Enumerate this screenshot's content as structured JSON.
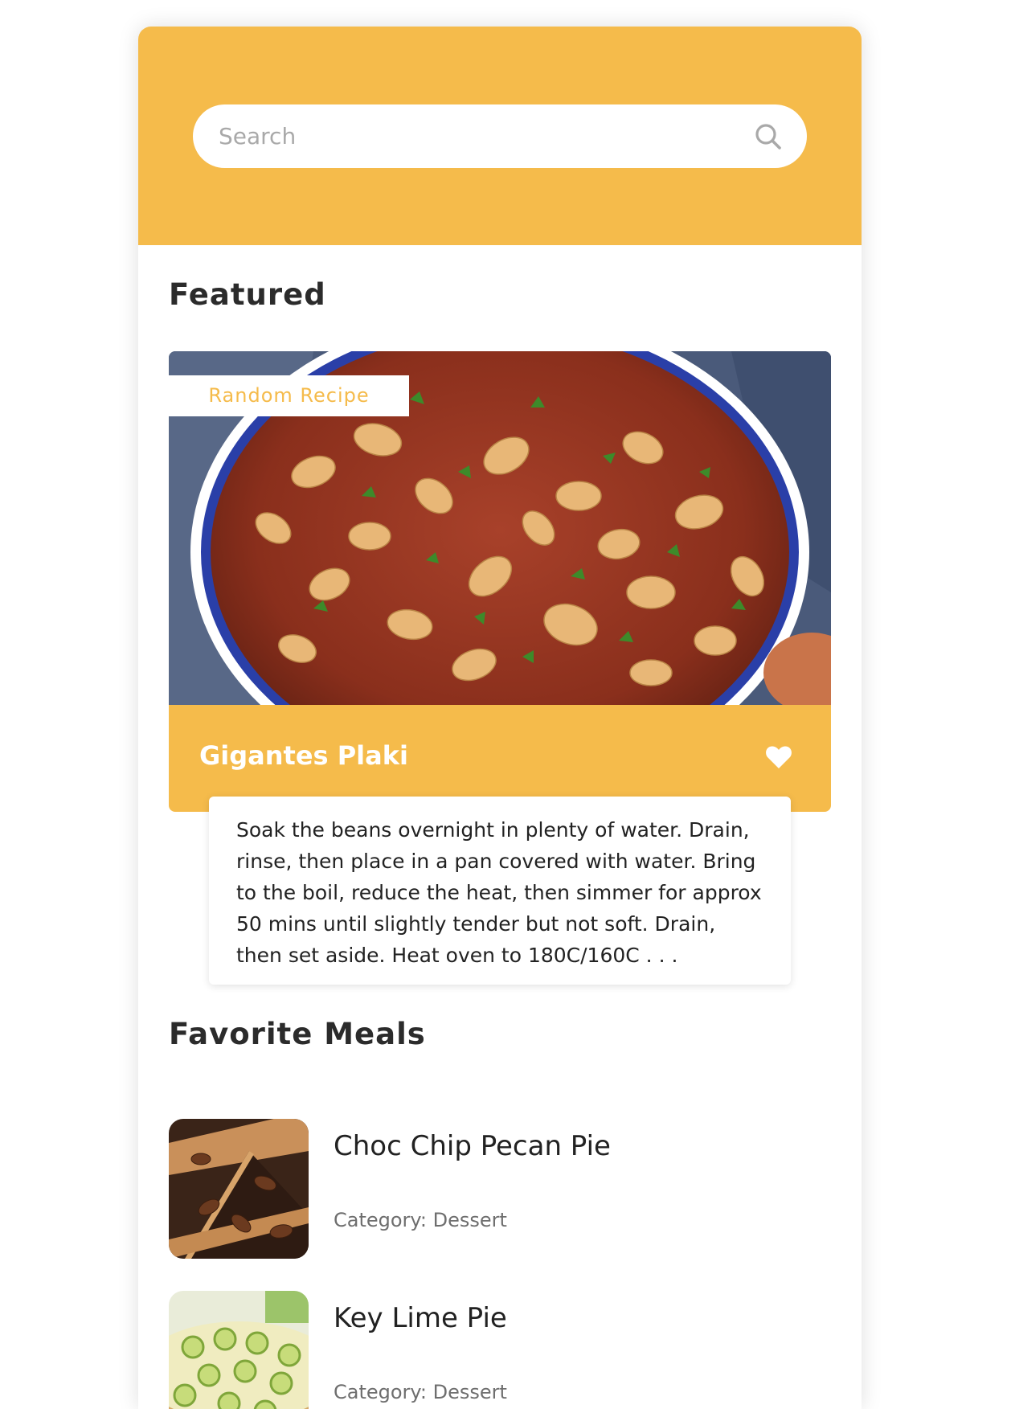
{
  "search": {
    "placeholder": "Search",
    "icon": "search-icon"
  },
  "featured": {
    "section_title": "Featured",
    "badge": "Random Recipe",
    "recipe_name": "Gigantes Plaki",
    "favorite_icon": "heart-icon",
    "description": "Soak the beans overnight in plenty of water. Drain, rinse, then place in a pan covered with water. Bring to the boil, reduce the heat, then simmer for approx 50 mins until slightly tender but not soft. Drain, then set aside. Heat oven to 180C/160C . . ."
  },
  "favorites": {
    "section_title": "Favorite Meals",
    "items": [
      {
        "name": "Choc Chip Pecan Pie",
        "category": "Category: Dessert"
      },
      {
        "name": "Key Lime Pie",
        "category": "Category: Dessert"
      }
    ]
  },
  "colors": {
    "accent": "#f5bb4b",
    "text": "#2b2b2b",
    "muted": "#6e6e6e"
  }
}
